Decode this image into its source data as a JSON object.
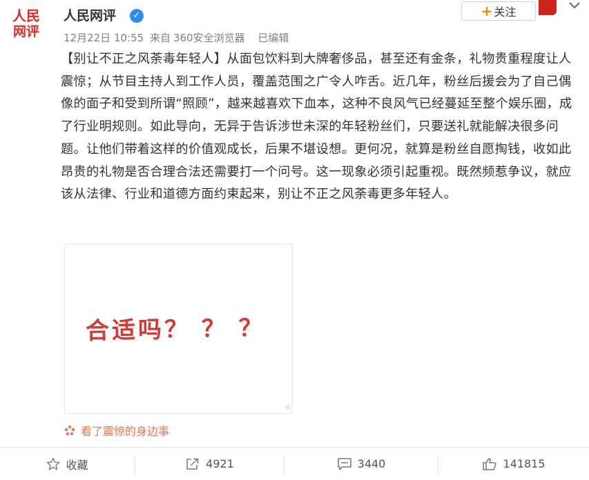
{
  "header": {
    "avatar_line1": "人民",
    "avatar_line2": "网评",
    "username": "人民网评",
    "verified_icon": "verified-badge-icon",
    "follow_label": "关注",
    "date": "12月22日 10:55",
    "source_prefix": "来自",
    "source": "360安全浏览器",
    "edited": "已编辑"
  },
  "post": {
    "text": "【别让不正之风荼毒年轻人】从面包饮料到大牌奢侈品，甚至还有金条，礼物贵重程度让人震惊；从节目主持人到工作人员，覆盖范围之广令人咋舌。近几年，粉丝后援会为了自己偶像的面子和受到所谓“照顾”，越来越喜欢下血本，这种不良风气已经蔓延至整个娱乐圈，成了行业明规则。如此导向，无异于告诉涉世未深的年轻粉丝们，只要送礼就能解决很多问题。让他们带着这样的价值观成长，后果不堪设想。更何况，就算是粉丝自愿掏钱，收如此昂贵的礼物是否合理合法还需要打一个问号。这一现象必须引起重视。既然频惹争议，就应该从法律、行业和道德方面约束起来，别让不正之风荼毒更多年轻人。",
    "image_text": "合适吗？ ？ ？",
    "source_link": "看了震惊的身边事"
  },
  "actions": {
    "favorite": "收藏",
    "repost": "4921",
    "comment": "3440",
    "like": "141815"
  },
  "colors": {
    "accent": "#ff8200",
    "link": "#eb7350",
    "brand_red": "#d92b2b"
  }
}
